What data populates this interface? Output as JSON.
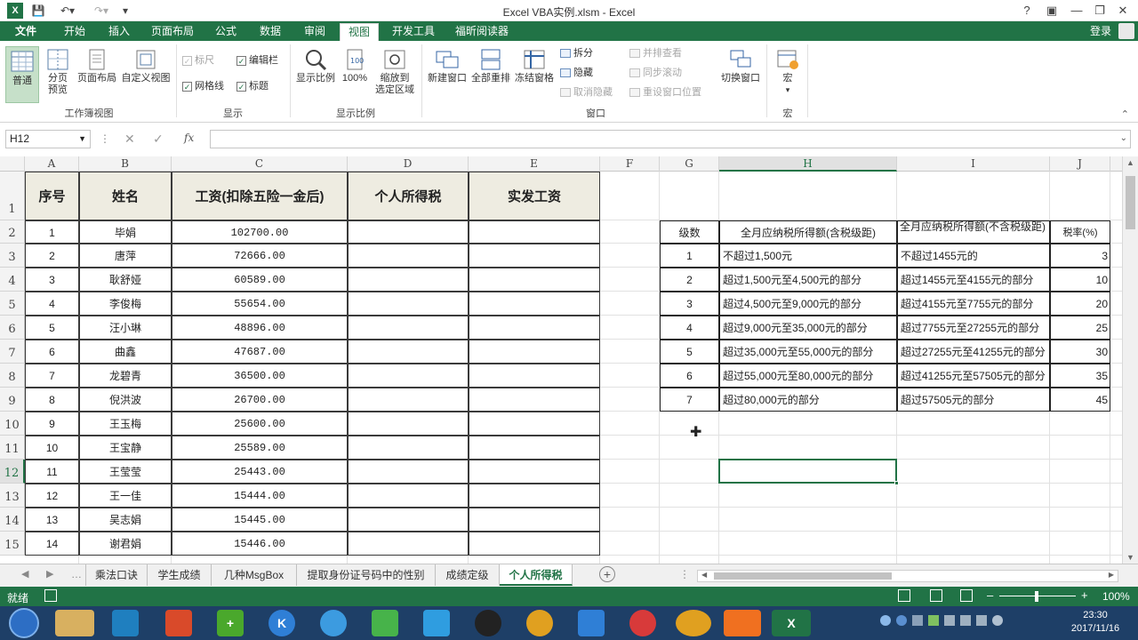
{
  "window": {
    "title": "Excel VBA实例.xlsm - Excel",
    "help": "?",
    "login": "登录"
  },
  "ribbon_tabs": [
    "文件",
    "开始",
    "插入",
    "页面布局",
    "公式",
    "数据",
    "审阅",
    "视图",
    "开发工具",
    "福昕阅读器"
  ],
  "active_tab": "视图",
  "ribbon": {
    "workbook_views": {
      "label": "工作簿视图",
      "normal": "普通",
      "page_break_1": "分页",
      "page_break_2": "预览",
      "page_layout": "页面布局",
      "custom": "自定义视图"
    },
    "show": {
      "label": "显示",
      "ruler": "标尺",
      "formula_bar": "编辑栏",
      "gridlines": "网格线",
      "headings": "标题"
    },
    "zoom": {
      "label": "显示比例",
      "zoom": "显示比例",
      "zoom100": "100%",
      "zoom_sel_1": "缩放到",
      "zoom_sel_2": "选定区域"
    },
    "window": {
      "label": "窗口",
      "new_window": "新建窗口",
      "arrange_all": "全部重排",
      "freeze": "冻结窗格",
      "split": "拆分",
      "hide": "隐藏",
      "unhide": "取消隐藏",
      "side_by_side": "并排查看",
      "sync_scroll": "同步滚动",
      "reset_pos": "重设窗口位置",
      "switch": "切换窗口"
    },
    "macros": {
      "label": "宏",
      "macros": "宏"
    }
  },
  "formula_bar": {
    "name_box": "H12",
    "fx": "fx",
    "value": ""
  },
  "columns": [
    "A",
    "B",
    "C",
    "D",
    "E",
    "F",
    "G",
    "H",
    "I",
    "J"
  ],
  "rows": [
    "1",
    "2",
    "3",
    "4",
    "5",
    "6",
    "7",
    "8",
    "9",
    "10",
    "11",
    "12",
    "13",
    "14",
    "15"
  ],
  "selected_cell": "H12",
  "main_table": {
    "headers": [
      "序号",
      "姓名",
      "工资(扣除五险一金后)",
      "个人所得税",
      "实发工资"
    ],
    "rows": [
      [
        "1",
        "毕娟",
        "102700.00"
      ],
      [
        "2",
        "唐萍",
        "72666.00"
      ],
      [
        "3",
        "耿舒娅",
        "60589.00"
      ],
      [
        "4",
        "李俊梅",
        "55654.00"
      ],
      [
        "5",
        "汪小琳",
        "48896.00"
      ],
      [
        "6",
        "曲鑫",
        "47687.00"
      ],
      [
        "7",
        "龙碧青",
        "36500.00"
      ],
      [
        "8",
        "倪洪波",
        "26700.00"
      ],
      [
        "9",
        "王玉梅",
        "25600.00"
      ],
      [
        "10",
        "王宝静",
        "25589.00"
      ],
      [
        "11",
        "王莹莹",
        "25443.00"
      ],
      [
        "12",
        "王一佳",
        "15444.00"
      ],
      [
        "13",
        "吴志娟",
        "15445.00"
      ],
      [
        "14",
        "谢君娟",
        "15446.00"
      ]
    ]
  },
  "tax_table": {
    "headers": [
      "级数",
      "全月应纳税所得额(含税级距)",
      "全月应纳税所得额(不含税级距)",
      "税率(%)"
    ],
    "rows": [
      [
        "1",
        "不超过1,500元",
        "不超过1455元的",
        "3"
      ],
      [
        "2",
        "超过1,500元至4,500元的部分",
        "超过1455元至4155元的部分",
        "10"
      ],
      [
        "3",
        "超过4,500元至9,000元的部分",
        "超过4155元至7755元的部分",
        "20"
      ],
      [
        "4",
        "超过9,000元至35,000元的部分",
        "超过7755元至27255元的部分",
        "25"
      ],
      [
        "5",
        "超过35,000元至55,000元的部分",
        "超过27255元至41255元的部分",
        "30"
      ],
      [
        "6",
        "超过55,000元至80,000元的部分",
        "超过41255元至57505元的部分",
        "35"
      ],
      [
        "7",
        "超过80,000元的部分",
        "超过57505元的部分",
        "45"
      ]
    ]
  },
  "sheet_tabs": [
    "乘法口诀",
    "学生成绩",
    "几种MsgBox",
    "提取身份证号码中的性别",
    "成绩定级",
    "个人所得税"
  ],
  "active_sheet": "个人所得税",
  "status": {
    "ready": "就绪",
    "zoom": "100%"
  },
  "taskbar": {
    "time": "23:30",
    "date": "2017/11/16"
  },
  "colors": {
    "excel_green": "#217346",
    "header_fill": "#eeece1",
    "taskbar": "#1e3f67"
  }
}
